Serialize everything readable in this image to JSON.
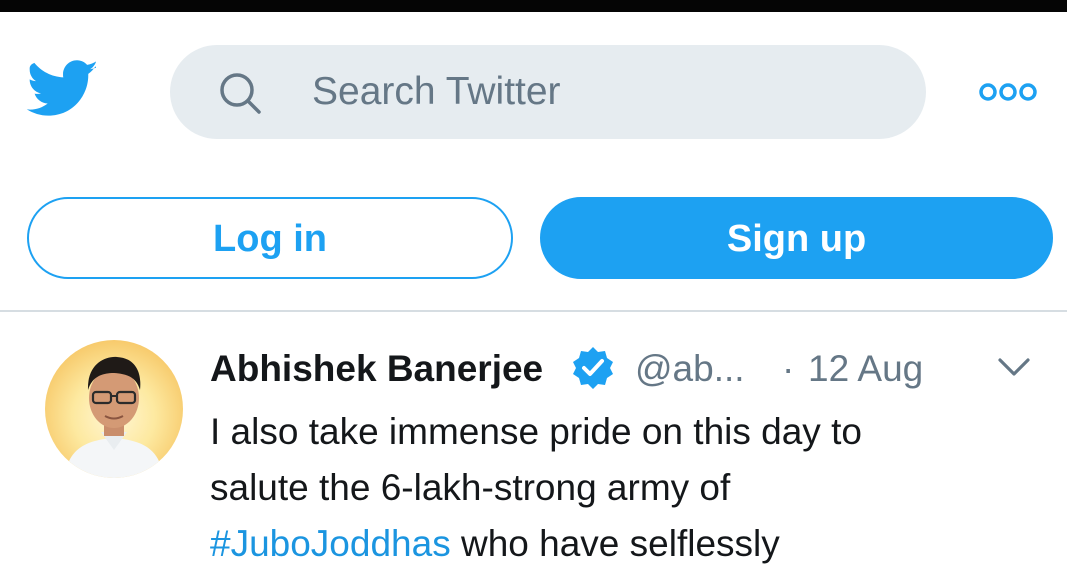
{
  "colors": {
    "brand": "#1da1f2",
    "hashtag": "#1b95e0",
    "search_bg": "#e6ecf0",
    "muted_text": "#657786",
    "primary_text": "#14171a"
  },
  "header": {
    "logo_icon": "twitter-bird-icon",
    "search": {
      "placeholder": "Search Twitter",
      "icon": "search-icon"
    },
    "more_icon": "more-dots-icon"
  },
  "auth": {
    "login_label": "Log in",
    "signup_label": "Sign up"
  },
  "tweet": {
    "author_name": "Abhishek Banerjee",
    "verified_icon": "verified-badge-icon",
    "handle": "@ab...",
    "separator": "·",
    "timestamp": "12 Aug",
    "caret_icon": "chevron-down-icon",
    "text_line_1": "I also take immense pride on this day to",
    "text_line_2": "salute the 6-lakh-strong army of",
    "hashtag": "#JuboJoddhas",
    "text_line_3_rest": " who have selflessly"
  }
}
